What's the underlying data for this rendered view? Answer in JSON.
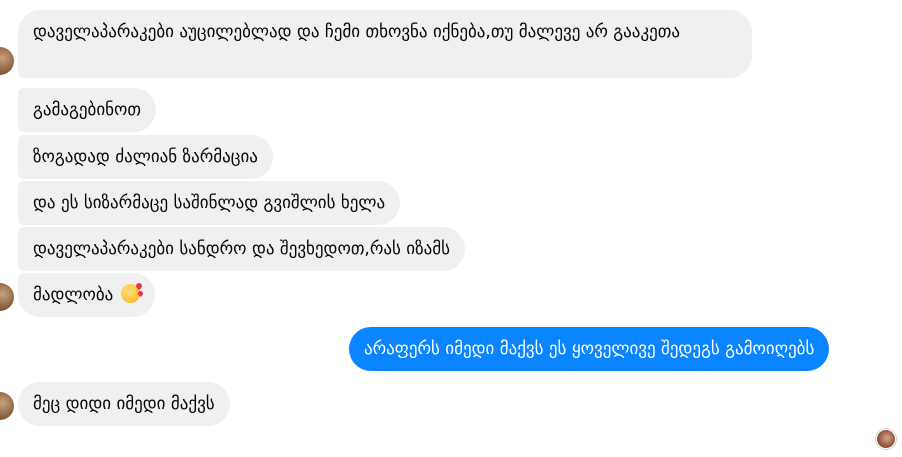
{
  "messages": [
    {
      "direction": "in",
      "text": "დაველაპარაკები აუცილებლად და ჩემი თხოვნა იქნება,თუ მალევე არ გააკეთა"
    },
    {
      "direction": "in",
      "text": "გამაგებინოთ"
    },
    {
      "direction": "in",
      "text": "ზოგადად ძალიან ზარმაცია"
    },
    {
      "direction": "in",
      "text": "და ეს სიზარმაცე საშინლად გვიშლის ხელა"
    },
    {
      "direction": "in",
      "text": "დაველაპარაკები სანდრო და შევხედოთ,რას იზამს"
    },
    {
      "direction": "in",
      "text": "მადლობა",
      "emoji": "smiling-face-with-hearts"
    },
    {
      "direction": "out",
      "text": "არაფერს იმედი მაქვს ეს ყოველივე შედეგს გამოიღებს"
    },
    {
      "direction": "in",
      "text": "მეც დიდი იმედი მაქვს"
    }
  ],
  "colors": {
    "incoming_bubble": "#f0f0f0",
    "outgoing_bubble": "#0a84ff",
    "incoming_text": "#050505",
    "outgoing_text": "#ffffff"
  }
}
